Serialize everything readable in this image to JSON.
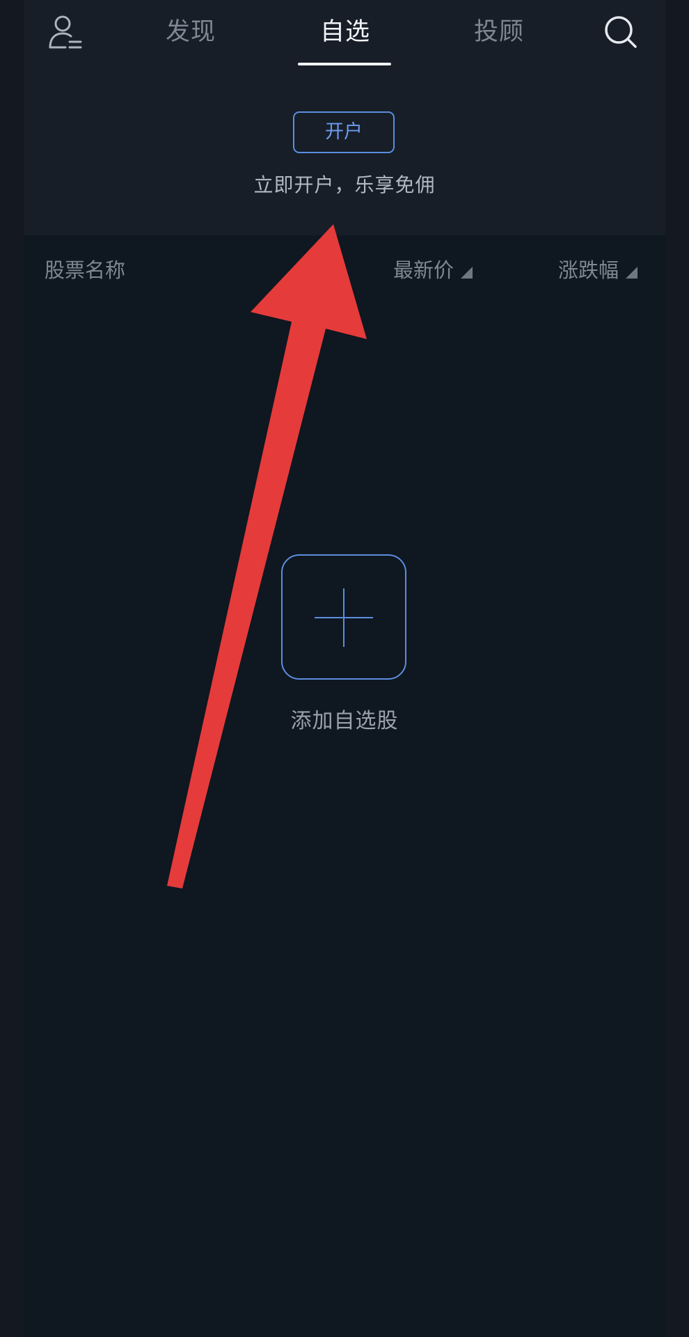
{
  "header": {
    "tabs": [
      {
        "label": "发现"
      },
      {
        "label": "自选"
      },
      {
        "label": "投顾"
      }
    ],
    "active_tab": "自选",
    "icons": {
      "left": "user-icon",
      "right": "search-icon"
    }
  },
  "promo": {
    "button_label": "开户",
    "tagline": "立即开户，乐享免佣"
  },
  "list_header": {
    "name": "股票名称",
    "price": "最新价",
    "change": "涨跌幅"
  },
  "empty_state": {
    "add_label": "添加自选股"
  },
  "colors": {
    "background": "#0f1720",
    "panel": "#171e28",
    "accent": "#5d8ee0",
    "arrow": "#e53b3b"
  }
}
